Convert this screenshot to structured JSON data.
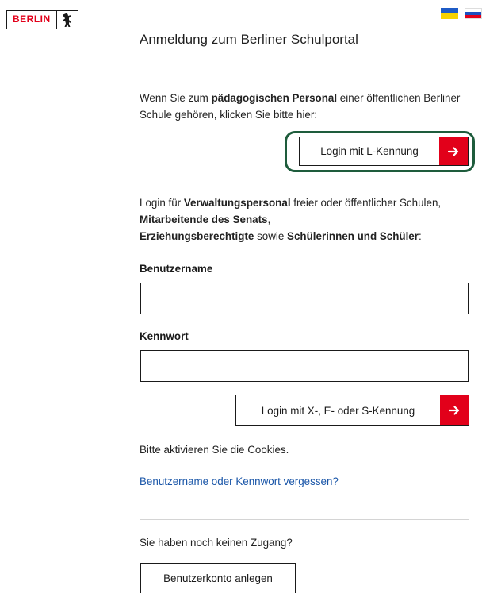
{
  "logo": {
    "text": "BERLIN",
    "icon": "berlin-bear-icon",
    "color": "#e2001a"
  },
  "flags": [
    {
      "name": "ukraine-flag-icon",
      "colors": [
        "#1e5bc6",
        "#f7d200"
      ]
    },
    {
      "name": "russia-flag-icon",
      "colors": [
        "#ffffff",
        "#1c4fbf",
        "#e2001a"
      ]
    }
  ],
  "page": {
    "title": "Anmeldung zum Berliner Schulportal"
  },
  "intro": {
    "part1": "Wenn Sie zum ",
    "bold1": "pädagogischen Personal",
    "part2": " einer öffentlichen Berliner Schule gehören, klicken Sie bitte hier:"
  },
  "login_l": {
    "label": "Login mit L-Kennung",
    "icon": "arrow-right-icon"
  },
  "login_desc": {
    "p1": "Login für ",
    "b1": "Verwaltungspersonal",
    "p2": " freier oder öffentlicher Schulen, ",
    "b2": "Mitarbeitende des Senats",
    "p3": ",",
    "b3": "Erziehungsberechtigte",
    "p4": " sowie ",
    "b4": "Schülerinnen und Schüler",
    "p5": ":"
  },
  "form": {
    "username_label": "Benutzername",
    "username_value": "",
    "password_label": "Kennwort",
    "password_value": ""
  },
  "login_x": {
    "label": "Login mit X-, E- oder S-Kennung",
    "icon": "arrow-right-icon"
  },
  "cookies_notice": "Bitte aktivieren Sie die Cookies.",
  "forgot_link": "Benutzername oder Kennwort vergessen?",
  "no_access": "Sie haben noch keinen Zugang?",
  "create_account": "Benutzerkonto anlegen",
  "colors": {
    "accent": "#e2001a",
    "link": "#1a56a8",
    "highlight": "#1e5c3c"
  }
}
